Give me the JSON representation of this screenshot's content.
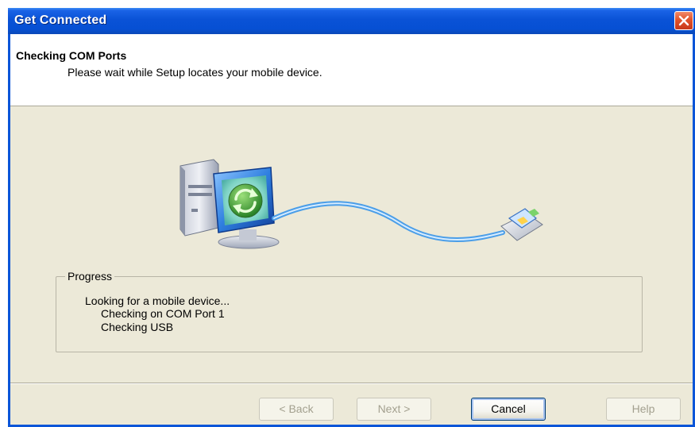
{
  "window": {
    "title": "Get Connected",
    "close_icon": "close-icon",
    "colors": {
      "titlebar": "#0a52d6",
      "close": "#e2532a",
      "face": "#ece9d8"
    }
  },
  "header": {
    "title": "Checking COM Ports",
    "subtitle": "Please wait while Setup locates your mobile device."
  },
  "illustration": {
    "icons": [
      "computer-icon",
      "sync-icon",
      "usb-cable-icon",
      "mobile-device-icon"
    ]
  },
  "progress": {
    "legend": "Progress",
    "lines": [
      "Looking for a mobile device...",
      "Checking on COM Port 1",
      "Checking USB"
    ]
  },
  "buttons": {
    "back": {
      "label": "< Back",
      "enabled": false
    },
    "next": {
      "label": "Next >",
      "enabled": false
    },
    "cancel": {
      "label": "Cancel",
      "enabled": true
    },
    "help": {
      "label": "Help",
      "enabled": false
    }
  }
}
